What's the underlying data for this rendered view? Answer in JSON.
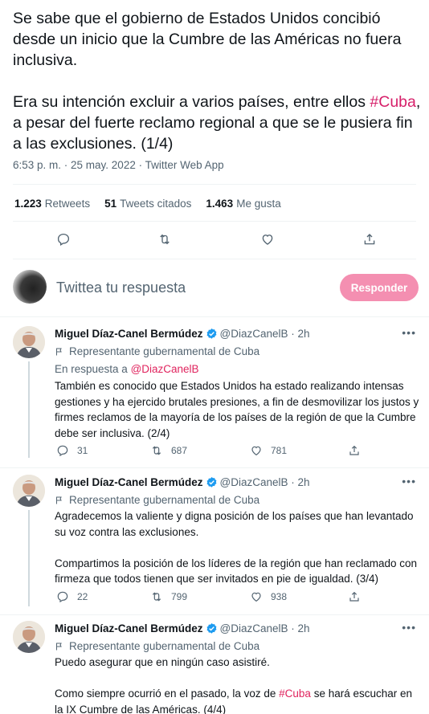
{
  "main_tweet": {
    "paragraph1": "Se sabe que el gobierno de Estados Unidos concibió desde un inicio que la Cumbre de las Américas no fuera inclusiva.",
    "paragraph2_before": "Era su intención excluir a varios países, entre ellos ",
    "paragraph2_hashtag": "#Cuba",
    "paragraph2_after": ", a pesar del fuerte reclamo regional a que se le pusiera fin a las exclusiones. (1/4)",
    "meta": "6:53 p. m. · 25 may. 2022 · Twitter Web App",
    "stats": {
      "retweets_count": "1.223",
      "retweets_label": "Retweets",
      "quotes_count": "51",
      "quotes_label": "Tweets citados",
      "likes_count": "1.463",
      "likes_label": "Me gusta"
    },
    "action_icons": [
      "reply-icon",
      "retweet-icon",
      "like-icon",
      "share-icon"
    ]
  },
  "reply_box": {
    "placeholder": "Twittea tu respuesta",
    "button_label": "Responder",
    "button_color": "#f48fb1"
  },
  "replies": [
    {
      "name": "Miguel Díaz-Canel Bermúdez",
      "handle": "@DiazCanelB",
      "time": "· 2h",
      "label": "Representante gubernamental de Cuba",
      "in_reply_prefix": "En respuesta a ",
      "in_reply_mention": "@DiazCanelB",
      "text": "También es conocido que Estados Unidos ha estado realizando intensas gestiones y ha ejercido brutales presiones, a fin de desmovilizar los justos y firmes reclamos de la mayoría de los países de la región de que la Cumbre debe ser inclusiva. (2/4)",
      "replies": "31",
      "retweets": "687",
      "likes": "781"
    },
    {
      "name": "Miguel Díaz-Canel Bermúdez",
      "handle": "@DiazCanelB",
      "time": "· 2h",
      "label": "Representante gubernamental de Cuba",
      "text1": "Agradecemos la valiente y digna posición de los países que han levantado su voz contra las exclusiones.",
      "text2": "Compartimos la posición de los líderes de la región que han reclamado con firmeza que todos tienen que ser invitados en pie de igualdad. (3/4)",
      "replies": "22",
      "retweets": "799",
      "likes": "938"
    },
    {
      "name": "Miguel Díaz-Canel Bermúdez",
      "handle": "@DiazCanelB",
      "time": "· 2h",
      "label": "Representante gubernamental de Cuba",
      "text1": "Puedo asegurar que en ningún caso asistiré.",
      "text2_before": "Como siempre ocurrió en el pasado, la voz de ",
      "text2_hashtag": "#Cuba",
      "text2_after": " se hará escuchar en la IX Cumbre de las Américas. (4/4)"
    }
  ],
  "colors": {
    "accent": "#e0245e",
    "muted": "#536471",
    "verified": "#1d9bf0",
    "text": "#0f1419"
  }
}
